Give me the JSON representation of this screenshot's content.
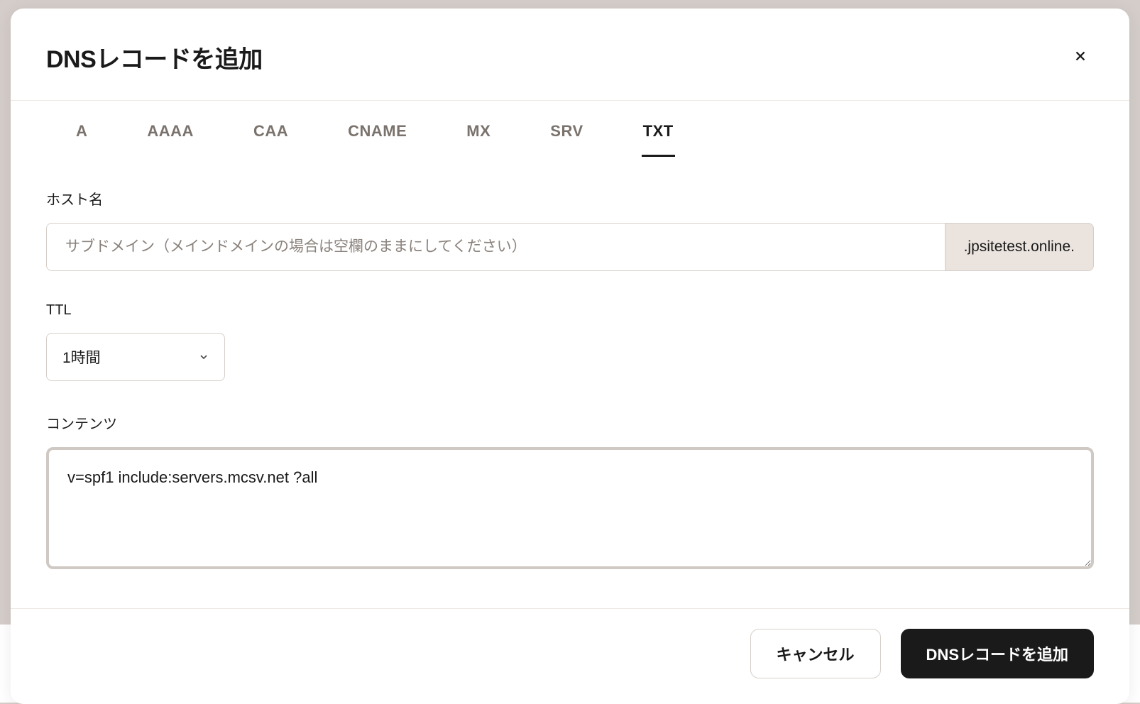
{
  "modal": {
    "title": "DNSレコードを追加"
  },
  "tabs": [
    {
      "label": "A",
      "active": false
    },
    {
      "label": "AAAA",
      "active": false
    },
    {
      "label": "CAA",
      "active": false
    },
    {
      "label": "CNAME",
      "active": false
    },
    {
      "label": "MX",
      "active": false
    },
    {
      "label": "SRV",
      "active": false
    },
    {
      "label": "TXT",
      "active": true
    }
  ],
  "fields": {
    "hostname": {
      "label": "ホスト名",
      "placeholder": "サブドメイン（メインドメインの場合は空欄のままにしてください）",
      "value": "",
      "suffix": ".jpsitetest.online."
    },
    "ttl": {
      "label": "TTL",
      "value": "1時間"
    },
    "content": {
      "label": "コンテンツ",
      "value": "v=spf1 include:servers.mcsv.net ?all"
    }
  },
  "footer": {
    "cancel": "キャンセル",
    "submit": "DNSレコードを追加"
  }
}
